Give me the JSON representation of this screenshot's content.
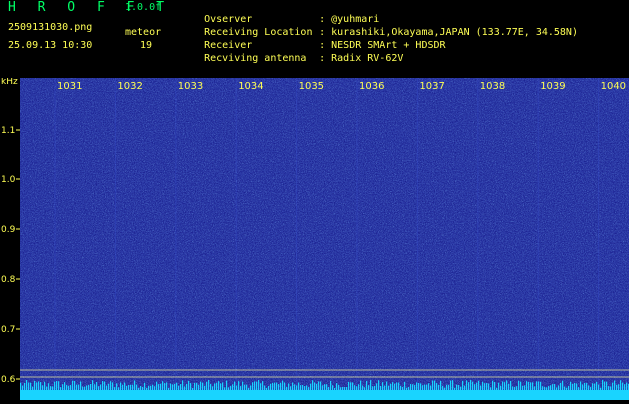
{
  "header": {
    "title": "H R O F F T",
    "version": "1.0.0f",
    "filename": "2509131030.png",
    "datetime": "25.09.13 10:30",
    "mode": "meteor",
    "count": "19"
  },
  "meta": [
    {
      "label": "Ovserver",
      "value": ": @yuhmari"
    },
    {
      "label": "Receiving Location",
      "value": ": kurashiki,Okayama,JAPAN (133.77E, 34.58N)"
    },
    {
      "label": "Receiver",
      "value": ": NESDR SMArt + HDSDR"
    },
    {
      "label": "Recviving antenna",
      "value": ": Radix RV-62V"
    }
  ],
  "axes": {
    "y_unit": "kHz",
    "y_ticks": [
      "1.1",
      "1.0",
      "0.9",
      "0.8",
      "0.7",
      "0.6"
    ],
    "x_ticks": [
      "1031",
      "1032",
      "1033",
      "1034",
      "1035",
      "1036",
      "1037",
      "1038",
      "1039",
      "1040"
    ]
  },
  "colors": {
    "background": "#000000",
    "spectrum_base": "#1a1f8f",
    "label_yellow": "#ffff55",
    "title_green": "#00ff66",
    "noise_floor": "#19d4ff"
  }
}
